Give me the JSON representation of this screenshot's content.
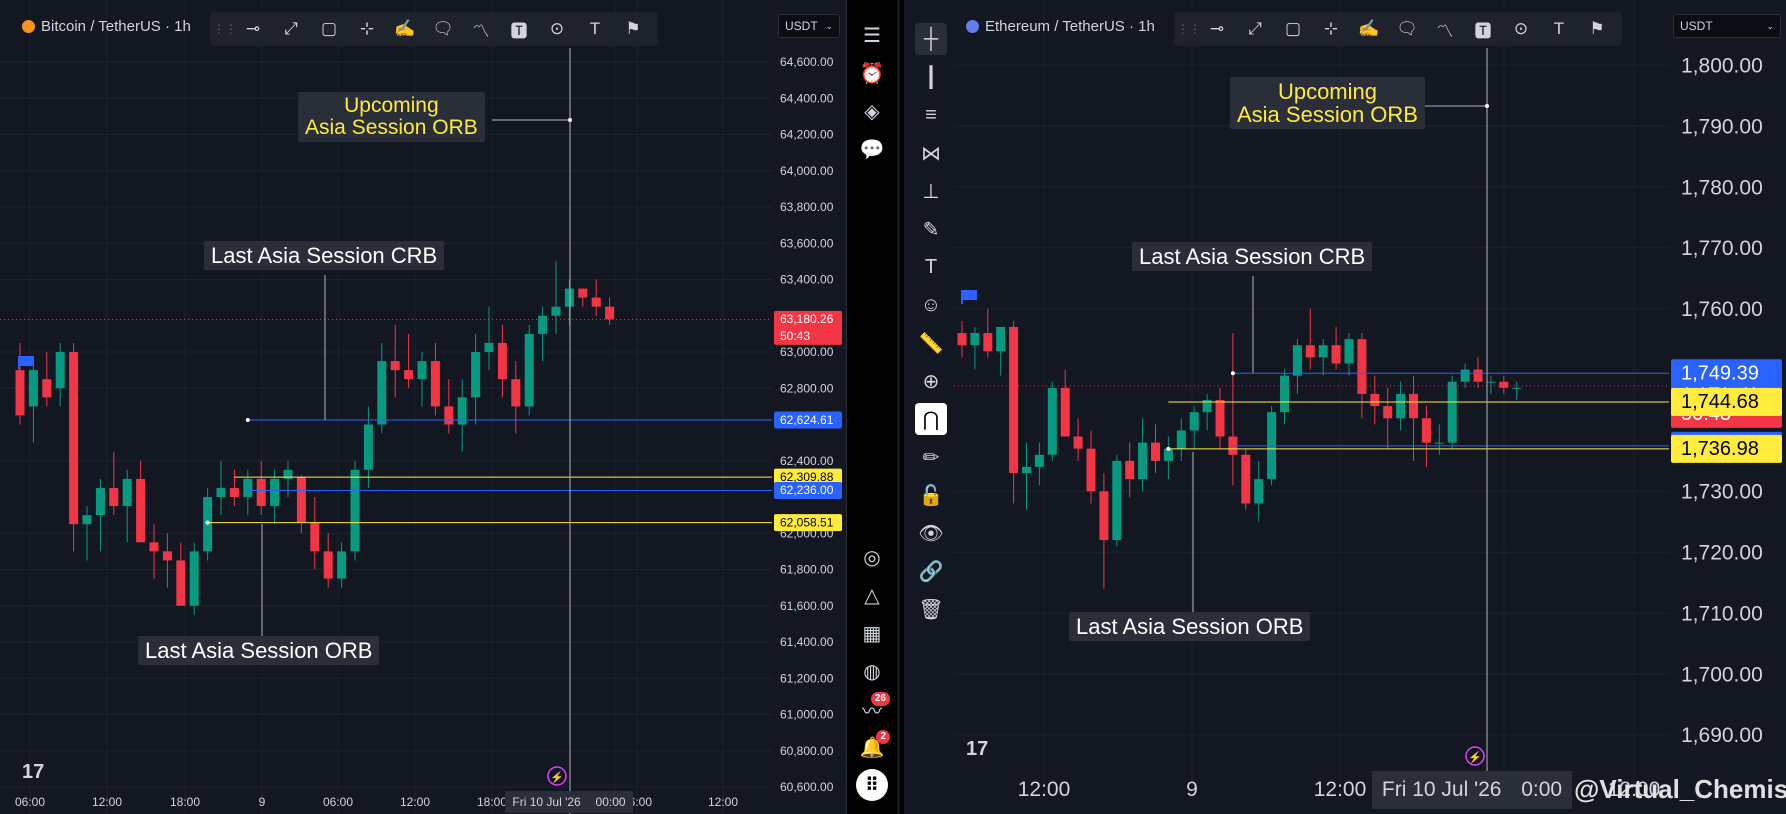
{
  "ui": {
    "left": {
      "symbol": "Bitcoin / TetherUS · 1h",
      "currency": "USDT",
      "time_label": "Fri 10 Jul '26",
      "time_label2": "00:00"
    },
    "right": {
      "symbol": "Ethereum / TetherUS · 1h",
      "currency": "USDT",
      "time_label": "Fri 10 Jul '26",
      "time_label2": "0:00",
      "watermark": "@Virtual_Chemist"
    },
    "sidebar": {
      "badge_ideas": "26",
      "badge_alerts": "2"
    },
    "icons": [
      "horizontal-line-icon",
      "trend-line-icon",
      "rectangle-icon",
      "vertical-line-icon",
      "brush-icon",
      "callout-icon",
      "path-icon",
      "text-box-icon",
      "target-icon",
      "text-icon",
      "flag-icon"
    ]
  },
  "colors": {
    "background": "#131722",
    "up": "#089981",
    "down": "#f23645",
    "blue_line": "#2962ff",
    "yellow_line": "#ffeb3b",
    "annotation_text_yellow": "#ffeb3b"
  },
  "chart_data": [
    {
      "type": "candlestick",
      "title": "Bitcoin / TetherUS · 1h",
      "x_ticks": [
        "06:00",
        "12:00",
        "18:00",
        "9",
        "06:00",
        "12:00",
        "18:00",
        "00:00",
        "06:00",
        "12:00"
      ],
      "y_ticks": [
        "64,600.00",
        "64,400.00",
        "64,200.00",
        "64,000.00",
        "63,800.00",
        "63,600.00",
        "63,400.00",
        "63,000.00",
        "62,800.00",
        "62,400.00",
        "61,800.00",
        "61,600.00",
        "61,400.00",
        "61,200.00",
        "61,000.00",
        "60,800.00",
        "60,600.00",
        "62,000.00"
      ],
      "ylim": [
        60600,
        64600
      ],
      "candles": [
        {
          "o": 62900,
          "h": 63050,
          "l": 62600,
          "c": 62650
        },
        {
          "o": 62700,
          "h": 62950,
          "l": 62500,
          "c": 62900
        },
        {
          "o": 62850,
          "h": 63000,
          "l": 62700,
          "c": 62750
        },
        {
          "o": 62800,
          "h": 63050,
          "l": 62700,
          "c": 63000
        },
        {
          "o": 63000,
          "h": 63050,
          "l": 61900,
          "c": 62050
        },
        {
          "o": 62050,
          "h": 62150,
          "l": 61850,
          "c": 62100
        },
        {
          "o": 62100,
          "h": 62300,
          "l": 61900,
          "c": 62250
        },
        {
          "o": 62250,
          "h": 62450,
          "l": 62100,
          "c": 62150
        },
        {
          "o": 62150,
          "h": 62350,
          "l": 61950,
          "c": 62300
        },
        {
          "o": 62300,
          "h": 62400,
          "l": 62100,
          "c": 61950
        },
        {
          "o": 61950,
          "h": 62050,
          "l": 61750,
          "c": 61900
        },
        {
          "o": 61900,
          "h": 62000,
          "l": 61700,
          "c": 61850
        },
        {
          "o": 61850,
          "h": 61950,
          "l": 61650,
          "c": 61600
        },
        {
          "o": 61600,
          "h": 61950,
          "l": 61550,
          "c": 61900
        },
        {
          "o": 61900,
          "h": 62250,
          "l": 61850,
          "c": 62200
        },
        {
          "o": 62200,
          "h": 62400,
          "l": 62100,
          "c": 62250
        },
        {
          "o": 62250,
          "h": 62350,
          "l": 62150,
          "c": 62200
        },
        {
          "o": 62200,
          "h": 62350,
          "l": 62100,
          "c": 62300
        },
        {
          "o": 62300,
          "h": 62400,
          "l": 62100,
          "c": 62150
        },
        {
          "o": 62150,
          "h": 62350,
          "l": 62050,
          "c": 62300
        },
        {
          "o": 62300,
          "h": 62400,
          "l": 62200,
          "c": 62350
        },
        {
          "o": 62310,
          "h": 62320,
          "l": 62000,
          "c": 62060
        },
        {
          "o": 62060,
          "h": 62200,
          "l": 61800,
          "c": 61900
        },
        {
          "o": 61900,
          "h": 62000,
          "l": 61700,
          "c": 61750
        },
        {
          "o": 61750,
          "h": 61950,
          "l": 61700,
          "c": 61900
        },
        {
          "o": 61900,
          "h": 62400,
          "l": 61850,
          "c": 62350
        },
        {
          "o": 62350,
          "h": 62700,
          "l": 62250,
          "c": 62600
        },
        {
          "o": 62600,
          "h": 63050,
          "l": 62550,
          "c": 62950
        },
        {
          "o": 62950,
          "h": 63150,
          "l": 62750,
          "c": 62900
        },
        {
          "o": 62900,
          "h": 63100,
          "l": 62800,
          "c": 62850
        },
        {
          "o": 62850,
          "h": 63000,
          "l": 62700,
          "c": 62950
        },
        {
          "o": 62950,
          "h": 63050,
          "l": 62650,
          "c": 62700
        },
        {
          "o": 62700,
          "h": 62850,
          "l": 62550,
          "c": 62600
        },
        {
          "o": 62600,
          "h": 62850,
          "l": 62450,
          "c": 62750
        },
        {
          "o": 62750,
          "h": 63100,
          "l": 62600,
          "c": 63000
        },
        {
          "o": 63000,
          "h": 63250,
          "l": 62900,
          "c": 63050
        },
        {
          "o": 63050,
          "h": 63150,
          "l": 62750,
          "c": 62850
        },
        {
          "o": 62850,
          "h": 62950,
          "l": 62550,
          "c": 62700
        },
        {
          "o": 62700,
          "h": 63150,
          "l": 62650,
          "c": 63100
        },
        {
          "o": 63100,
          "h": 63250,
          "l": 62950,
          "c": 63200
        },
        {
          "o": 63200,
          "h": 63500,
          "l": 63100,
          "c": 63250
        },
        {
          "o": 63250,
          "h": 63400,
          "l": 63150,
          "c": 63350
        },
        {
          "o": 63350,
          "h": 63350,
          "l": 63250,
          "c": 63300
        },
        {
          "o": 63300,
          "h": 63400,
          "l": 63200,
          "c": 63250
        },
        {
          "o": 63250,
          "h": 63300,
          "l": 63150,
          "c": 63180
        }
      ],
      "levels": [
        {
          "value": 62624.61,
          "label": "62,624.61",
          "color": "#2962ff"
        },
        {
          "value": 62309.88,
          "label": "62,309.88",
          "color": "#ffeb3b"
        },
        {
          "value": 62236.0,
          "label": "62,236.00",
          "color": "#2962ff"
        },
        {
          "value": 62058.51,
          "label": "62,058.51",
          "color": "#ffeb3b"
        }
      ],
      "last_price": {
        "value": 63180.26,
        "label": "63,180.26",
        "countdown": "50:43"
      },
      "annotations": [
        {
          "text_lines": [
            "Upcoming",
            "Asia Session ORB"
          ],
          "color": "yellow"
        },
        {
          "text_lines": [
            "Last Asia Session CRB"
          ],
          "color": "white"
        },
        {
          "text_lines": [
            "Last Asia Session ORB"
          ],
          "color": "white"
        }
      ]
    },
    {
      "type": "candlestick",
      "title": "Ethereum / TetherUS · 1h",
      "x_ticks": [
        "12:00",
        "9",
        "12:00",
        "0:00",
        "12:00"
      ],
      "y_ticks": [
        "1,800.00",
        "1,790.00",
        "1,780.00",
        "1,770.00",
        "1,760.00",
        "1,720.00",
        "1,710.00",
        "1,700.00",
        "1,690.00",
        "1,730.00"
      ],
      "ylim": [
        1688,
        1802
      ],
      "candles": [
        {
          "o": 1756,
          "h": 1758,
          "l": 1752,
          "c": 1754
        },
        {
          "o": 1754,
          "h": 1757,
          "l": 1750,
          "c": 1756
        },
        {
          "o": 1756,
          "h": 1760,
          "l": 1752,
          "c": 1753
        },
        {
          "o": 1753,
          "h": 1757,
          "l": 1749,
          "c": 1757
        },
        {
          "o": 1757,
          "h": 1758,
          "l": 1728,
          "c": 1733
        },
        {
          "o": 1733,
          "h": 1738,
          "l": 1727,
          "c": 1734
        },
        {
          "o": 1734,
          "h": 1738,
          "l": 1731,
          "c": 1736
        },
        {
          "o": 1736,
          "h": 1748,
          "l": 1735,
          "c": 1747
        },
        {
          "o": 1747,
          "h": 1750,
          "l": 1740,
          "c": 1739
        },
        {
          "o": 1739,
          "h": 1742,
          "l": 1735,
          "c": 1737
        },
        {
          "o": 1737,
          "h": 1740,
          "l": 1728,
          "c": 1730
        },
        {
          "o": 1730,
          "h": 1733,
          "l": 1714,
          "c": 1722
        },
        {
          "o": 1722,
          "h": 1736,
          "l": 1721,
          "c": 1735
        },
        {
          "o": 1735,
          "h": 1738,
          "l": 1729,
          "c": 1732
        },
        {
          "o": 1732,
          "h": 1742,
          "l": 1730,
          "c": 1738
        },
        {
          "o": 1738,
          "h": 1741,
          "l": 1733,
          "c": 1735
        },
        {
          "o": 1735,
          "h": 1739,
          "l": 1732,
          "c": 1737
        },
        {
          "o": 1737,
          "h": 1742,
          "l": 1735,
          "c": 1740
        },
        {
          "o": 1740,
          "h": 1744,
          "l": 1737,
          "c": 1743
        },
        {
          "o": 1743,
          "h": 1746,
          "l": 1740,
          "c": 1745
        },
        {
          "o": 1745,
          "h": 1747,
          "l": 1737,
          "c": 1739
        },
        {
          "o": 1739,
          "h": 1756,
          "l": 1731,
          "c": 1736
        },
        {
          "o": 1736,
          "h": 1737,
          "l": 1727,
          "c": 1728
        },
        {
          "o": 1728,
          "h": 1735,
          "l": 1725,
          "c": 1732
        },
        {
          "o": 1732,
          "h": 1744,
          "l": 1731,
          "c": 1743
        },
        {
          "o": 1743,
          "h": 1750,
          "l": 1741,
          "c": 1749
        },
        {
          "o": 1749,
          "h": 1755,
          "l": 1746,
          "c": 1754
        },
        {
          "o": 1754,
          "h": 1760,
          "l": 1750,
          "c": 1752
        },
        {
          "o": 1752,
          "h": 1755,
          "l": 1749,
          "c": 1754
        },
        {
          "o": 1754,
          "h": 1757,
          "l": 1750,
          "c": 1751
        },
        {
          "o": 1751,
          "h": 1756,
          "l": 1749,
          "c": 1755
        },
        {
          "o": 1755,
          "h": 1756,
          "l": 1742,
          "c": 1746
        },
        {
          "o": 1746,
          "h": 1749,
          "l": 1741,
          "c": 1744
        },
        {
          "o": 1744,
          "h": 1747,
          "l": 1737,
          "c": 1742
        },
        {
          "o": 1742,
          "h": 1748,
          "l": 1740,
          "c": 1746
        },
        {
          "o": 1746,
          "h": 1749,
          "l": 1735,
          "c": 1742
        },
        {
          "o": 1742,
          "h": 1744,
          "l": 1734,
          "c": 1738
        },
        {
          "o": 1738,
          "h": 1741,
          "l": 1736,
          "c": 1738
        },
        {
          "o": 1738,
          "h": 1749,
          "l": 1737,
          "c": 1748
        },
        {
          "o": 1748,
          "h": 1751,
          "l": 1747,
          "c": 1750
        },
        {
          "o": 1750,
          "h": 1752,
          "l": 1747,
          "c": 1748
        },
        {
          "o": 1748,
          "h": 1749,
          "l": 1746,
          "c": 1748
        },
        {
          "o": 1748,
          "h": 1749,
          "l": 1746,
          "c": 1747
        },
        {
          "o": 1747,
          "h": 1748,
          "l": 1745,
          "c": 1747
        }
      ],
      "levels": [
        {
          "value": 1749.39,
          "label": "1,749.39",
          "color": "#2962ff"
        },
        {
          "value": 1744.68,
          "label": "1,744.68",
          "color": "#ffeb3b"
        },
        {
          "value": 1737.46,
          "label": "1,737.46",
          "color": "#2962ff"
        },
        {
          "value": 1736.98,
          "label": "1,736.98",
          "color": "#ffeb3b"
        }
      ],
      "last_price": {
        "value": 1747.31,
        "label": "1,747.31",
        "countdown": "50:43"
      },
      "annotations": [
        {
          "text_lines": [
            "Upcoming",
            "Asia Session ORB"
          ],
          "color": "yellow"
        },
        {
          "text_lines": [
            "Last Asia Session CRB"
          ],
          "color": "white"
        },
        {
          "text_lines": [
            "Last Asia Session ORB"
          ],
          "color": "white"
        }
      ]
    }
  ]
}
